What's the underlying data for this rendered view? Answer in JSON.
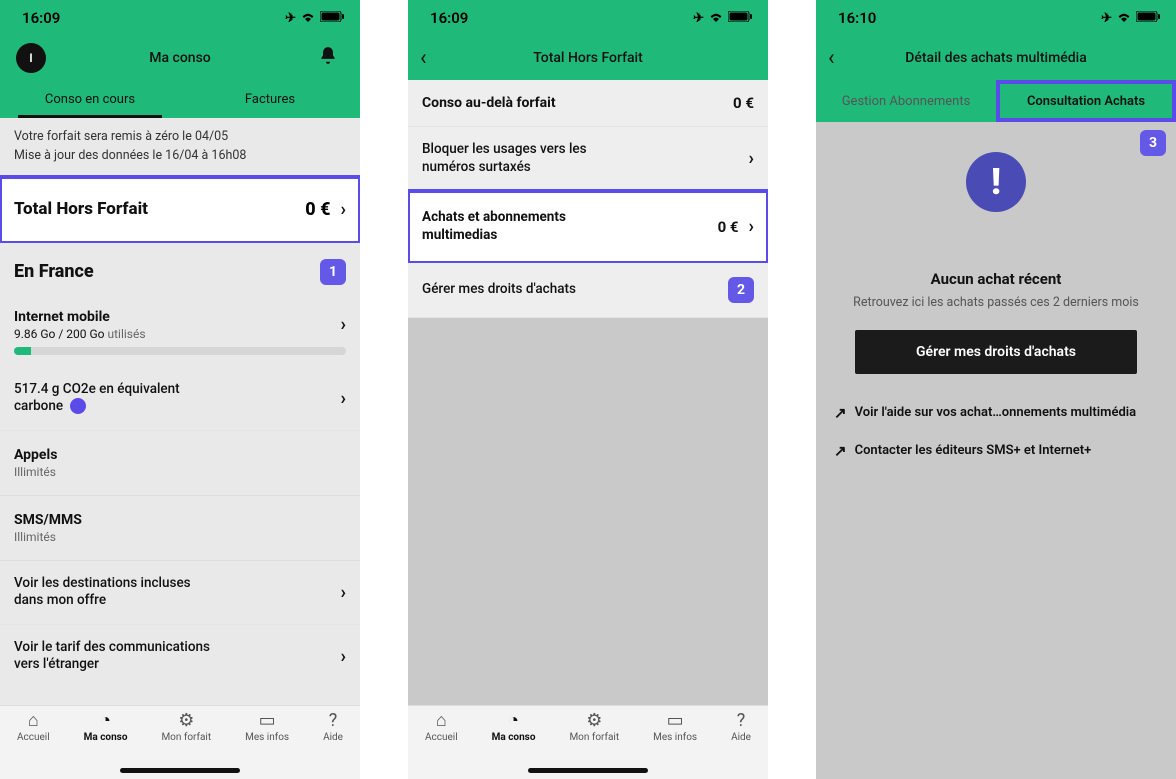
{
  "screen1": {
    "time": "16:09",
    "title": "Ma conso",
    "avatar_letter": "I",
    "tabs": {
      "current": "Conso en cours",
      "bills": "Factures"
    },
    "banner_line1": "Votre forfait sera remis à zéro le 04/05",
    "banner_line2": "Mise à jour des données le 16/04 à 16h08",
    "total_label": "Total Hors Forfait",
    "total_value": "0 €",
    "badge1": "1",
    "france_head": "En France",
    "internet_label": "Internet mobile",
    "internet_usage_used": "9.86 Go / 200 Go",
    "internet_usage_word": " utilisés",
    "carbon_line": "517.4 g CO2e en équivalent carbone",
    "calls_label": "Appels",
    "calls_val": "Illimités",
    "sms_label": "SMS/MMS",
    "sms_val": "Illimités",
    "dest_label": "Voir les destinations incluses dans mon offre",
    "tarif_label": "Voir le tarif des communications vers l'étranger"
  },
  "screen2": {
    "time": "16:09",
    "title": "Total Hors Forfait",
    "row1_label": "Conso au-delà forfait",
    "row1_val": "0 €",
    "row2_label": "Bloquer les usages vers les numéros surtaxés",
    "row3_label": "Achats et abonnements multimedias",
    "row3_val": "0 €",
    "row4_label": "Gérer mes droits d'achats",
    "badge2": "2"
  },
  "screen3": {
    "time": "16:10",
    "title": "Détail des achats multimédia",
    "subtab1": "Gestion Abonnements",
    "subtab2": "Consultation Achats",
    "badge3": "3",
    "empty_title": "Aucun achat récent",
    "empty_sub": "Retrouvez ici les achats passés ces 2 derniers mois",
    "btn": "Gérer mes droits d'achats",
    "link1": "Voir l'aide sur vos achat…onnements multimédia",
    "link2": "Contacter les éditeurs SMS+ et Internet+"
  },
  "tabbar": {
    "home": "Accueil",
    "conso": "Ma conso",
    "forfait": "Mon forfait",
    "infos": "Mes infos",
    "aide": "Aide"
  }
}
